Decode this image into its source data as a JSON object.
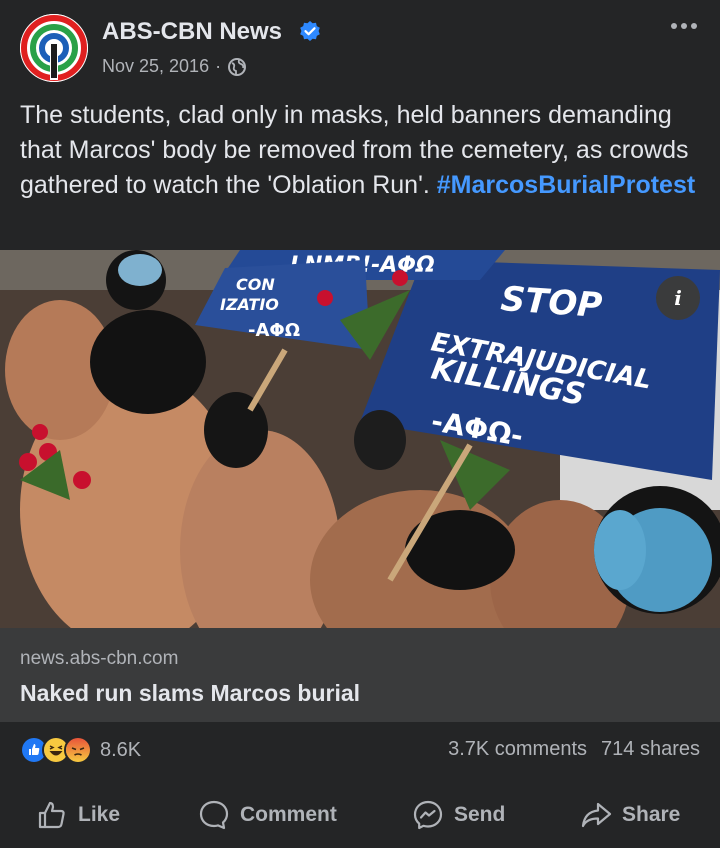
{
  "post": {
    "page_name": "ABS-CBN News",
    "date": "Nov 25, 2016",
    "separator": "·",
    "caption_text": "The students, clad only in masks, held banners demanding that Marcos' body be removed from the cemetery, as crowds gathered to watch the 'Oblation Run'. ",
    "hashtag": "#MarcosBurialProtest"
  },
  "photo": {
    "sign_main": [
      "STOP",
      "EXTRAJUDICIAL",
      "KILLINGS",
      "-ΑΦΩ-"
    ],
    "sign_top": "LNMB!-ΑΦΩ",
    "sign_left": [
      "CON",
      "IZATIO",
      "-ΑΦΩ"
    ]
  },
  "link": {
    "domain": "news.abs-cbn.com",
    "title": "Naked run slams Marcos burial"
  },
  "stats": {
    "reaction_count": "8.6K",
    "comments": "3.7K comments",
    "shares": "714 shares"
  },
  "actions": {
    "like": "Like",
    "comment": "Comment",
    "send": "Send",
    "share": "Share"
  },
  "icons": {
    "verified": "verified-badge-icon",
    "globe": "globe-icon",
    "more": "more-icon",
    "info": "info-icon"
  },
  "colors": {
    "background": "#242526",
    "link_background": "#3a3b3c",
    "accent": "#4599ff",
    "secondary_text": "#b0b3b8"
  }
}
